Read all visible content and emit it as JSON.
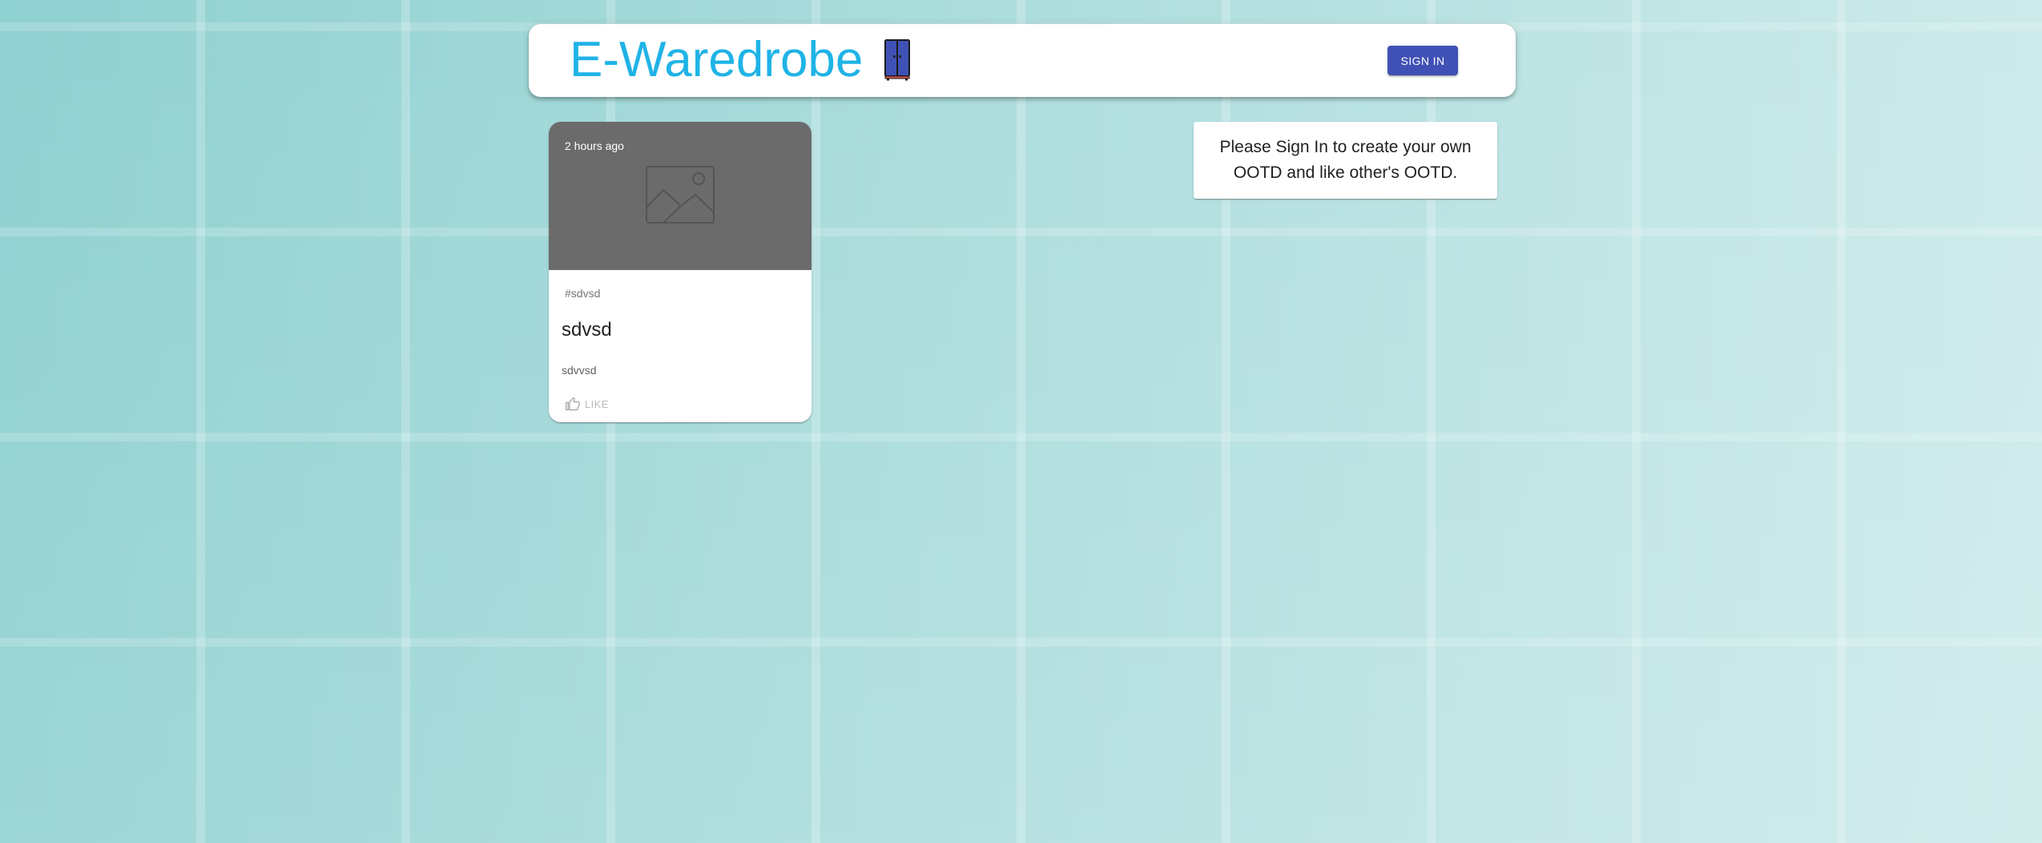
{
  "header": {
    "title": "E-Waredrobe",
    "logo_icon": "wardrobe-icon",
    "sign_in_label": "SIGN IN",
    "accent_color": "#1fb3e6",
    "button_color": "#3f51b5"
  },
  "posts": [
    {
      "time": "2 hours ago",
      "image": "image-placeholder-icon",
      "tags": "#sdvsd",
      "title": "sdvsd",
      "message": "sdvvsd",
      "like_label": "LIKE",
      "like_icon": "thumb-up-icon"
    }
  ],
  "sign_in_prompt": {
    "text": "Please Sign In to create your own OOTD and like other's OOTD."
  }
}
